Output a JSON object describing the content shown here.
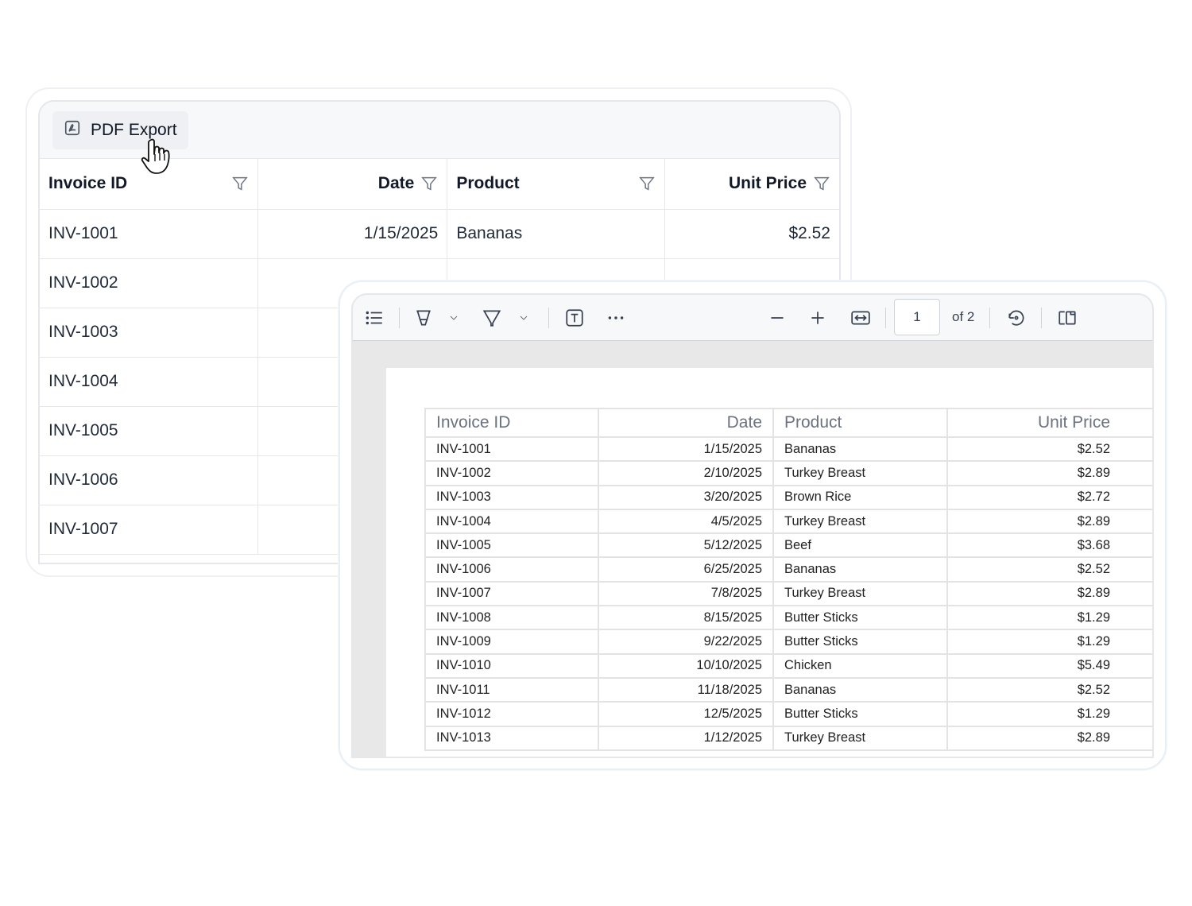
{
  "grid": {
    "toolbar": {
      "pdf_export_label": "PDF Export"
    },
    "columns": [
      "Invoice ID",
      "Date",
      "Product",
      "Unit Price"
    ],
    "rows": [
      [
        "INV-1001",
        "1/15/2025",
        "Bananas",
        "$2.52"
      ],
      [
        "INV-1002",
        "",
        "",
        ""
      ],
      [
        "INV-1003",
        "",
        "",
        ""
      ],
      [
        "INV-1004",
        "",
        "",
        ""
      ],
      [
        "INV-1005",
        "",
        "",
        ""
      ],
      [
        "INV-1006",
        "",
        "",
        ""
      ],
      [
        "INV-1007",
        "",
        "",
        ""
      ]
    ]
  },
  "pdf_viewer": {
    "current_page": "1",
    "page_count_label": "of 2",
    "document": {
      "columns": [
        "Invoice ID",
        "Date",
        "Product",
        "Unit Price"
      ],
      "rows": [
        [
          "INV-1001",
          "1/15/2025",
          "Bananas",
          "$2.52"
        ],
        [
          "INV-1002",
          "2/10/2025",
          "Turkey Breast",
          "$2.89"
        ],
        [
          "INV-1003",
          "3/20/2025",
          "Brown Rice",
          "$2.72"
        ],
        [
          "INV-1004",
          "4/5/2025",
          "Turkey Breast",
          "$2.89"
        ],
        [
          "INV-1005",
          "5/12/2025",
          "Beef",
          "$3.68"
        ],
        [
          "INV-1006",
          "6/25/2025",
          "Bananas",
          "$2.52"
        ],
        [
          "INV-1007",
          "7/8/2025",
          "Turkey Breast",
          "$2.89"
        ],
        [
          "INV-1008",
          "8/15/2025",
          "Butter Sticks",
          "$1.29"
        ],
        [
          "INV-1009",
          "9/22/2025",
          "Butter Sticks",
          "$1.29"
        ],
        [
          "INV-1010",
          "10/10/2025",
          "Chicken",
          "$5.49"
        ],
        [
          "INV-1011",
          "11/18/2025",
          "Bananas",
          "$2.52"
        ],
        [
          "INV-1012",
          "12/5/2025",
          "Butter Sticks",
          "$1.29"
        ],
        [
          "INV-1013",
          "1/12/2025",
          "Turkey Breast",
          "$2.89"
        ]
      ]
    }
  },
  "icons": {
    "export": "pdf-export-icon",
    "filter": "filter-icon",
    "cursor": "hand-pointer-cursor-icon",
    "toc": "list-icon",
    "highlight": "highlight-pen-icon",
    "draw": "draw-pen-icon",
    "text": "text-box-icon",
    "more": "more-horizontal-icon",
    "zoom_out": "minus-icon",
    "zoom_in": "plus-icon",
    "fit_width": "fit-width-icon",
    "rotate": "rotate-icon",
    "page_view": "page-view-icon"
  }
}
